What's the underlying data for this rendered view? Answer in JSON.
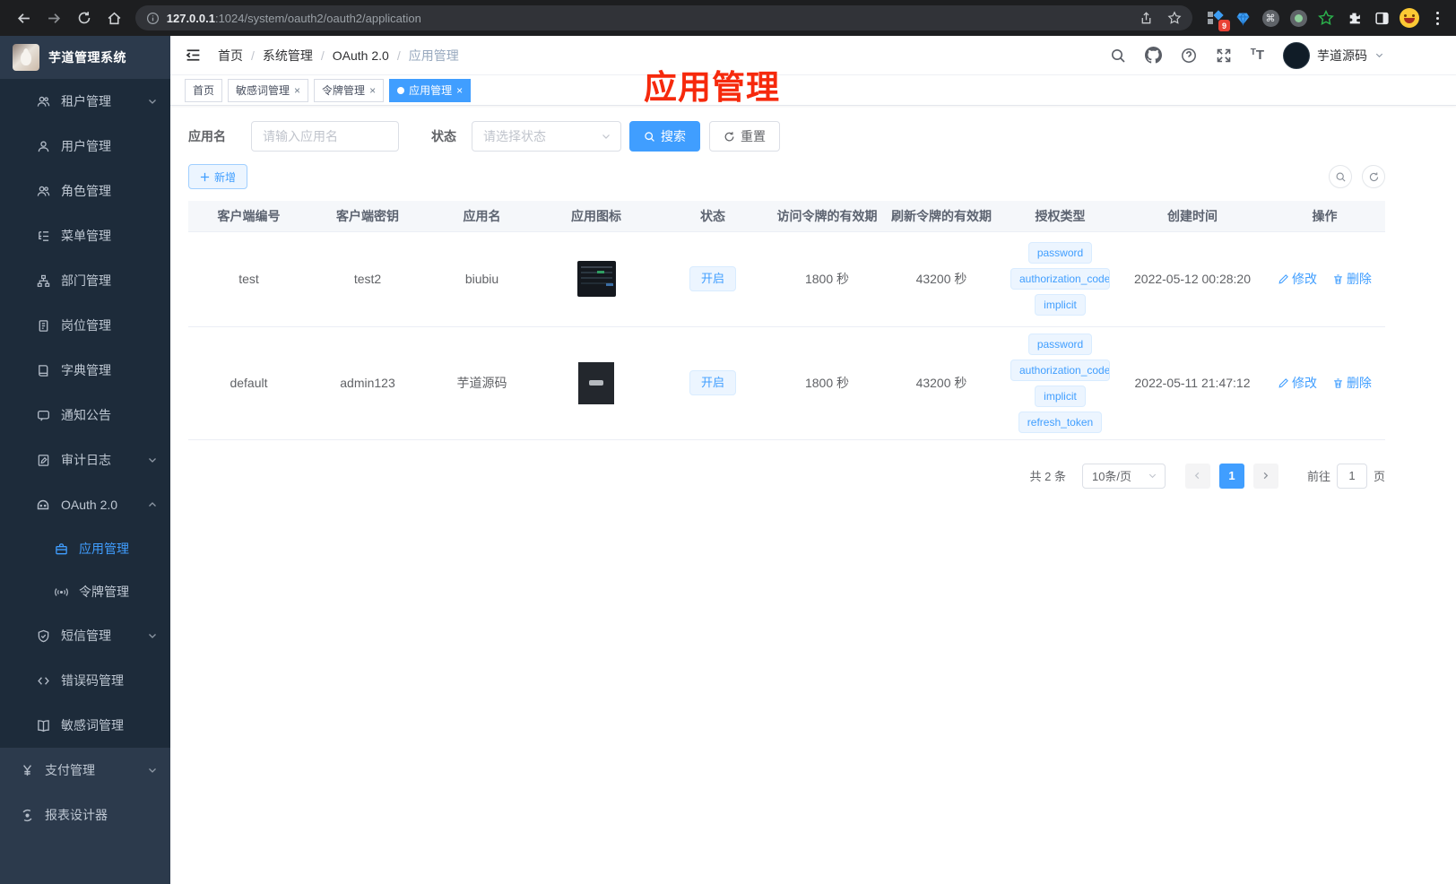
{
  "browser": {
    "host": "127.0.0.1",
    "url_rest": ":1024/system/oauth2/oauth2/application",
    "extension_badge": "9"
  },
  "sidebar": {
    "app_title": "芋道管理系统",
    "items": [
      {
        "label": "租户管理"
      },
      {
        "label": "用户管理"
      },
      {
        "label": "角色管理"
      },
      {
        "label": "菜单管理"
      },
      {
        "label": "部门管理"
      },
      {
        "label": "岗位管理"
      },
      {
        "label": "字典管理"
      },
      {
        "label": "通知公告"
      },
      {
        "label": "审计日志"
      },
      {
        "label": "OAuth 2.0"
      },
      {
        "label": "应用管理"
      },
      {
        "label": "令牌管理"
      },
      {
        "label": "短信管理"
      },
      {
        "label": "错误码管理"
      },
      {
        "label": "敏感词管理"
      },
      {
        "label": "支付管理"
      },
      {
        "label": "报表设计器"
      }
    ]
  },
  "navbar": {
    "breadcrumb": [
      "首页",
      "系统管理",
      "OAuth 2.0",
      "应用管理"
    ],
    "separator": "/",
    "username": "芋道源码"
  },
  "tabs": [
    {
      "label": "首页"
    },
    {
      "label": "敏感词管理"
    },
    {
      "label": "令牌管理"
    },
    {
      "label": "应用管理"
    }
  ],
  "glyphs": {
    "close": "×"
  },
  "overlay_title": "应用管理",
  "filters": {
    "name_label": "应用名",
    "name_placeholder": "请输入应用名",
    "status_label": "状态",
    "status_placeholder": "请选择状态",
    "search_label": "搜索",
    "reset_label": "重置"
  },
  "toolbar": {
    "add_label": "新增"
  },
  "table": {
    "columns": [
      "客户端编号",
      "客户端密钥",
      "应用名",
      "应用图标",
      "状态",
      "访问令牌的有效期",
      "刷新令牌的有效期",
      "授权类型",
      "创建时间",
      "操作"
    ],
    "rows": [
      {
        "client_id": "test",
        "client_secret": "test2",
        "name": "biubiu",
        "icon": "dark-dashboard-screenshot",
        "status": "开启",
        "access_token_validity": "1800 秒",
        "refresh_token_validity": "43200 秒",
        "grant_types": [
          "password",
          "authorization_code",
          "implicit"
        ],
        "create_time": "2022-05-12 00:28:20",
        "edit_label": "修改",
        "delete_label": "删除"
      },
      {
        "client_id": "default",
        "client_secret": "admin123",
        "name": "芋道源码",
        "icon": "dark-app-logo",
        "status": "开启",
        "access_token_validity": "1800 秒",
        "refresh_token_validity": "43200 秒",
        "grant_types": [
          "password",
          "authorization_code",
          "implicit",
          "refresh_token"
        ],
        "create_time": "2022-05-11 21:47:12",
        "edit_label": "修改",
        "delete_label": "删除"
      }
    ]
  },
  "pagination": {
    "total": "共 2 条",
    "page_size": "10条/页",
    "current_page": "1",
    "goto_label": "前往",
    "goto_value": "1",
    "page_label": "页"
  },
  "colors": {
    "primary": "#409eff",
    "overlay_red": "#f6290c",
    "sidebar_dark": "#1d2b3a",
    "sidebar_light": "#2c3a4c"
  }
}
